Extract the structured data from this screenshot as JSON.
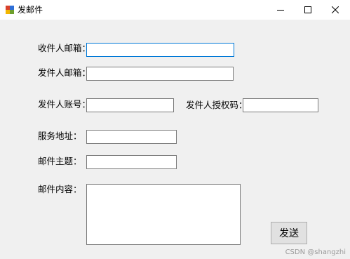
{
  "window": {
    "title": "发邮件"
  },
  "form": {
    "recipient_label": "收件人邮箱：",
    "recipient_value": "",
    "sender_label": "发件人邮箱：",
    "sender_value": "",
    "account_label": "发件人账号：",
    "account_value": "",
    "auth_code_label": "发件人授权码：",
    "auth_code_value": "",
    "server_label": "服务地址：",
    "server_value": "",
    "subject_label": "邮件主题：",
    "subject_value": "",
    "content_label": "邮件内容：",
    "content_value": ""
  },
  "actions": {
    "send_label": "发送"
  },
  "watermark": "CSDN @shangzhi",
  "colors": {
    "focus_border": "#0078d7",
    "window_bg": "#f0f0f0"
  }
}
